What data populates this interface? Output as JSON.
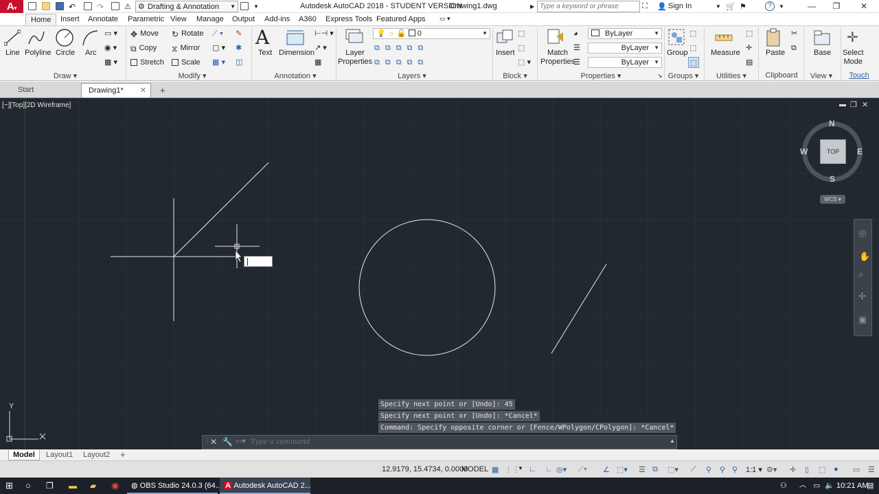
{
  "titlebar": {
    "workspace": "Drafting & Annotation",
    "title": "Autodesk AutoCAD 2018 - STUDENT VERSION",
    "drawing": "Drawing1.dwg",
    "search_placeholder": "Type a keyword or phrase",
    "sign_in": "Sign In"
  },
  "menu": {
    "tabs": [
      "Home",
      "Insert",
      "Annotate",
      "Parametric",
      "View",
      "Manage",
      "Output",
      "Add-ins",
      "A360",
      "Express Tools",
      "Featured Apps"
    ]
  },
  "ribbon": {
    "draw": {
      "line": "Line",
      "polyline": "Polyline",
      "circle": "Circle",
      "arc": "Arc",
      "label": "Draw"
    },
    "modify": {
      "move": "Move",
      "rotate": "Rotate",
      "copy": "Copy",
      "mirror": "Mirror",
      "stretch": "Stretch",
      "scale": "Scale",
      "label": "Modify"
    },
    "annotation": {
      "text": "Text",
      "dimension": "Dimension",
      "label": "Annotation"
    },
    "layers": {
      "layer_properties_1": "Layer",
      "layer_properties_2": "Properties",
      "current_layer": "0",
      "label": "Layers"
    },
    "block": {
      "insert": "Insert",
      "label": "Block"
    },
    "properties": {
      "match_1": "Match",
      "match_2": "Properties",
      "color": "ByLayer",
      "linetype": "ByLayer",
      "lineweight": "ByLayer",
      "label": "Properties"
    },
    "groups": {
      "group": "Group",
      "label": "Groups"
    },
    "utilities": {
      "measure": "Measure",
      "label": "Utilities"
    },
    "clipboard": {
      "paste": "Paste",
      "label": "Clipboard"
    },
    "view": {
      "base": "Base",
      "label": "View"
    },
    "touch": {
      "select_1": "Select",
      "select_2": "Mode",
      "label": "Touch"
    }
  },
  "doctabs": {
    "start": "Start",
    "drawing": "Drawing1*"
  },
  "viewport": {
    "label": "[−][Top][2D Wireframe]",
    "viewcube": {
      "n": "N",
      "s": "S",
      "e": "E",
      "w": "W",
      "top": "TOP",
      "wcs": "WCS"
    },
    "ucs": {
      "y": "Y"
    }
  },
  "command": {
    "history": [
      "Specify next point or [Undo]: 45",
      "Specify next point or [Undo]: *Cancel*",
      "Command: Specify opposite corner or [Fence/WPolygon/CPolygon]: *Cancel*"
    ],
    "placeholder": "Type a command"
  },
  "layouts": {
    "model": "Model",
    "layout1": "Layout1",
    "layout2": "Layout2"
  },
  "status": {
    "coords": "12.9179, 15.4734, 0.0000",
    "space": "MODEL",
    "scale": "1:1"
  },
  "taskbar": {
    "obs": "OBS Studio 24.0.3 (64...",
    "autocad": "Autodesk AutoCAD 2...",
    "time": "10:21 AM"
  },
  "colors": {
    "viewport_bg": "#212830",
    "ribbon_bg": "#f3f3f3",
    "autocad_red": "#c8102e",
    "taskbar_bg": "#1b2029"
  }
}
